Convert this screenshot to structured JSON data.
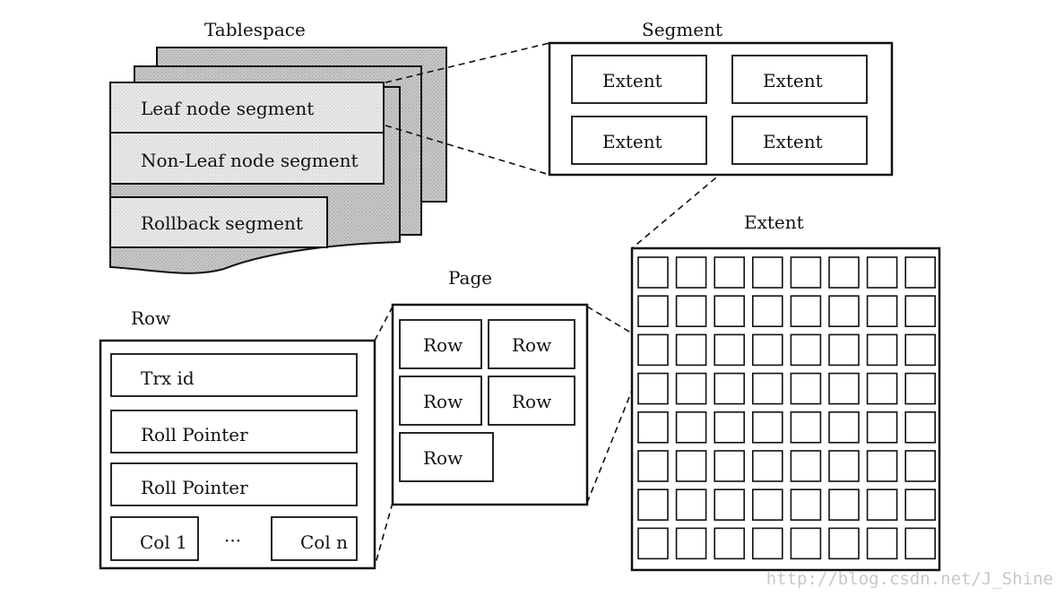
{
  "titles": {
    "tablespace": "Tablespace",
    "segment": "Segment",
    "extent": "Extent",
    "page": "Page",
    "row": "Row"
  },
  "tablespace": {
    "segments": [
      "Leaf node segment",
      "Non-Leaf node segment",
      "Rollback segment"
    ]
  },
  "segment": {
    "extents": [
      "Extent",
      "Extent",
      "Extent",
      "Extent"
    ]
  },
  "extent": {
    "rows": 8,
    "cols": 8
  },
  "page": {
    "rows": [
      "Row",
      "Row",
      "Row",
      "Row",
      "Row"
    ]
  },
  "row": {
    "fields": [
      "Trx id",
      "Roll Pointer",
      "Roll Pointer"
    ],
    "col_first": "Col 1",
    "ellipsis": "···",
    "col_last": "Col n"
  },
  "watermark": "http://blog.csdn.net/J_Shine",
  "colors": {
    "sheet": "#bdbdbd",
    "segment_fill": "#e4e4e4",
    "stroke": "#111111"
  }
}
